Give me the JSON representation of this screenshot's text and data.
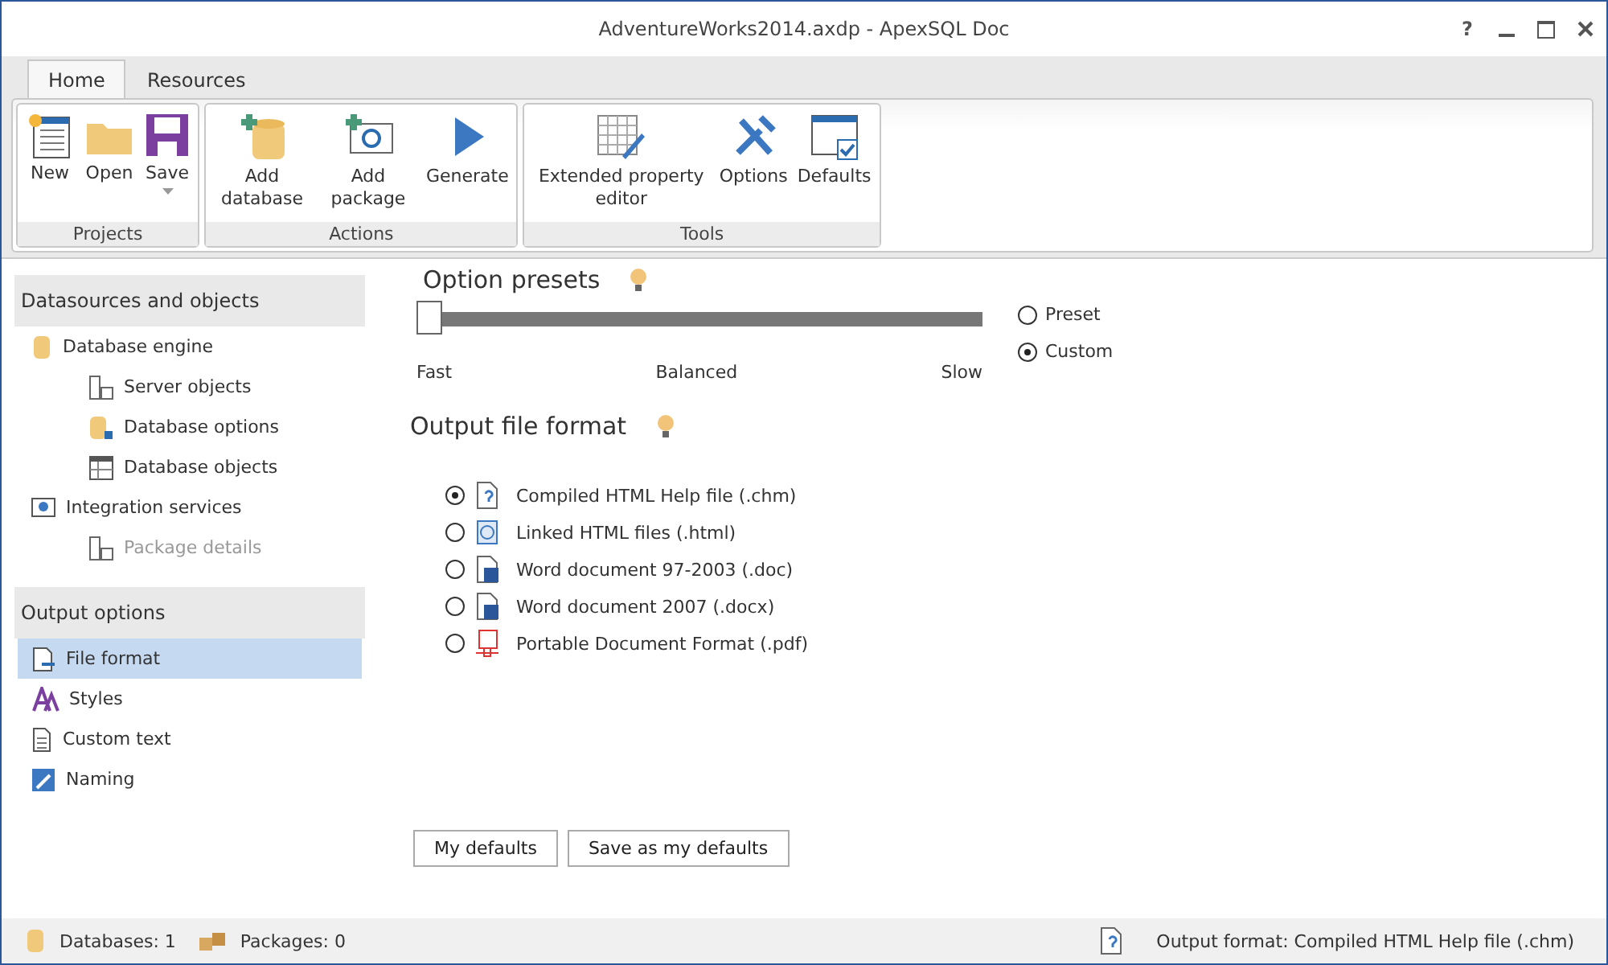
{
  "window": {
    "title": "AdventureWorks2014.axdp - ApexSQL Doc",
    "controls": [
      "?"
    ]
  },
  "tabs": [
    {
      "label": "Home",
      "selected": true
    },
    {
      "label": "Resources",
      "selected": false
    }
  ],
  "ribbon": [
    {
      "title": "Projects",
      "buttons": [
        {
          "label": "New",
          "kind": "new"
        },
        {
          "label": "Open",
          "kind": "open"
        },
        {
          "label": "Save",
          "kind": "save",
          "dropdown": true
        }
      ]
    },
    {
      "title": "Actions",
      "buttons": [
        {
          "label": "Add database",
          "kind": "add-database"
        },
        {
          "label": "Add package",
          "kind": "add-package"
        },
        {
          "label": "Generate",
          "kind": "generate"
        }
      ]
    },
    {
      "title": "Tools",
      "buttons": [
        {
          "label": "Extended property editor",
          "kind": "grid"
        },
        {
          "label": "Options",
          "kind": "options"
        },
        {
          "label": "Defaults",
          "kind": "defaults"
        }
      ]
    }
  ],
  "sidebar": [
    {
      "title": "Datasources and objects",
      "items": [
        {
          "label": "Database engine",
          "kind": "database",
          "selected": false,
          "disabled": false,
          "children": [
            {
              "label": "Server objects",
              "kind": "server",
              "selected": false,
              "disabled": false
            },
            {
              "label": "Database options",
              "kind": "dboptions",
              "selected": false,
              "disabled": false
            },
            {
              "label": "Database objects",
              "kind": "table",
              "selected": false,
              "disabled": false
            }
          ]
        },
        {
          "label": "Integration services",
          "kind": "package",
          "selected": false,
          "disabled": false,
          "children": [
            {
              "label": "Package details",
              "kind": "server",
              "selected": false,
              "disabled": true
            }
          ]
        }
      ]
    },
    {
      "title": "Output options",
      "items": [
        {
          "label": "File format",
          "kind": "fileformat",
          "selected": true,
          "disabled": false
        },
        {
          "label": "Styles",
          "kind": "styles",
          "selected": false,
          "disabled": false
        },
        {
          "label": "Custom text",
          "kind": "text",
          "selected": false,
          "disabled": false
        },
        {
          "label": "Naming",
          "kind": "naming",
          "selected": false,
          "disabled": false
        }
      ]
    }
  ],
  "presets": {
    "title": "Option presets",
    "level": 0,
    "ticks": [
      "Fast",
      "Balanced",
      "Slow"
    ],
    "modes": [
      {
        "label": "Preset",
        "selected": false
      },
      {
        "label": "Custom",
        "selected": true
      }
    ]
  },
  "output_format": {
    "title": "Output file format",
    "formats": [
      {
        "label": "Compiled HTML Help file (.chm)",
        "kind": "chm",
        "selected": true
      },
      {
        "label": "Linked HTML files (.html)",
        "kind": "html",
        "selected": false
      },
      {
        "label": "Word document 97-2003 (.doc)",
        "kind": "word",
        "selected": false
      },
      {
        "label": "Word document 2007 (.docx)",
        "kind": "word",
        "selected": false
      },
      {
        "label": "Portable Document Format (.pdf)",
        "kind": "pdf",
        "selected": false
      }
    ]
  },
  "buttons": [
    "My defaults",
    "Save as my defaults"
  ],
  "status_bar": {
    "databases": "Databases: 1",
    "packages": "Packages: 0",
    "output": "Output format: Compiled HTML Help file (.chm)"
  }
}
